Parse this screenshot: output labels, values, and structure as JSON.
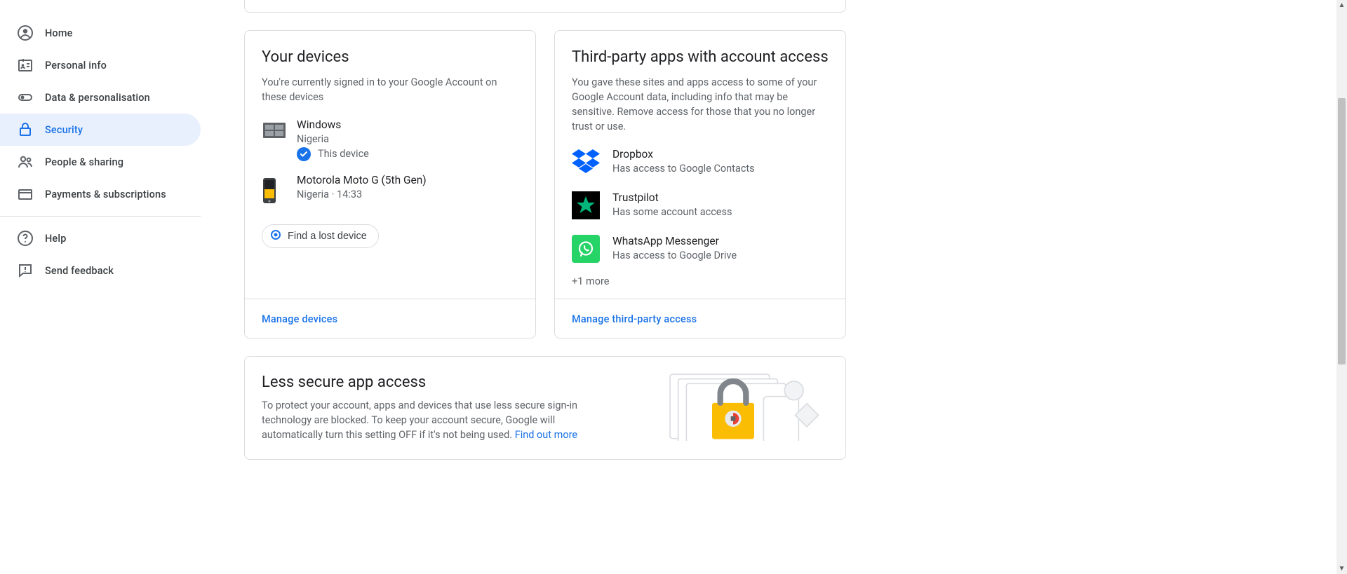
{
  "sidebar": {
    "items": [
      {
        "label": "Home"
      },
      {
        "label": "Personal info"
      },
      {
        "label": "Data & personalisation"
      },
      {
        "label": "Security"
      },
      {
        "label": "People & sharing"
      },
      {
        "label": "Payments & subscriptions"
      }
    ],
    "help_label": "Help",
    "feedback_label": "Send feedback"
  },
  "devices_card": {
    "title": "Your devices",
    "desc": "You're currently signed in to your Google Account on these devices",
    "devices": [
      {
        "name": "Windows",
        "location": "Nigeria",
        "this_device_label": "This device"
      },
      {
        "name": "Motorola Moto G (5th Gen)",
        "location": "Nigeria · 14:33"
      }
    ],
    "find_btn": "Find a lost device",
    "manage_link": "Manage devices"
  },
  "apps_card": {
    "title": "Third-party apps with account access",
    "desc": "You gave these sites and apps access to some of your Google Account data, including info that may be sensitive. Remove access for those that you no longer trust or use.",
    "apps": [
      {
        "name": "Dropbox",
        "access": "Has access to Google Contacts"
      },
      {
        "name": "Trustpilot",
        "access": "Has some account access"
      },
      {
        "name": "WhatsApp Messenger",
        "access": "Has access to Google Drive"
      }
    ],
    "more_label": "+1 more",
    "manage_link": "Manage third-party access"
  },
  "less_secure_card": {
    "title": "Less secure app access",
    "desc_part1": "To protect your account, apps and devices that use less secure sign-in technology are blocked. To keep your account secure, Google will automatically turn this setting OFF if it's not being used. ",
    "find_out_more": "Find out more"
  }
}
